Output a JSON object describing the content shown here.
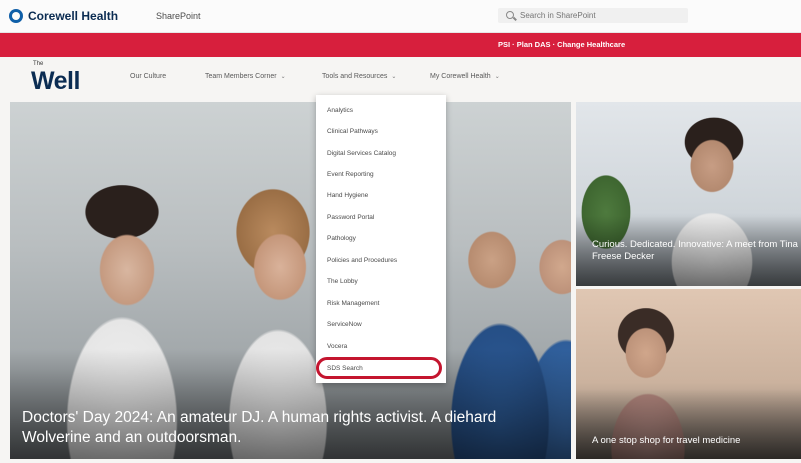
{
  "topbar": {
    "brand": "Corewell Health",
    "app_name": "SharePoint",
    "search_placeholder": "Search in SharePoint",
    "brand_color": "#0b2c52"
  },
  "alert_banner": {
    "text": "PSI · Plan DAS · Change Healthcare",
    "color": "#d71f3d"
  },
  "site": {
    "logo_prefix": "The",
    "logo_name": "Well"
  },
  "nav": {
    "items": [
      {
        "label": "Our Culture",
        "has_chevron": false
      },
      {
        "label": "Team Members Corner",
        "has_chevron": true
      },
      {
        "label": "Tools and Resources",
        "has_chevron": true
      },
      {
        "label": "My Corewell Health",
        "has_chevron": true
      }
    ]
  },
  "dropdown": {
    "items": [
      "Analytics",
      "Clinical Pathways",
      "Digital Services Catalog",
      "Event Reporting",
      "Hand Hygiene",
      "Password Portal",
      "Pathology",
      "Policies and Procedures",
      "The Lobby",
      "Risk Management",
      "ServiceNow",
      "Vocera",
      "SDS Search"
    ],
    "highlighted_item": "SDS Search",
    "highlight_color": "#c4152f"
  },
  "hero": {
    "caption": "Doctors' Day 2024: An amateur DJ. A human rights activist. A diehard Wolverine and an outdoorsman."
  },
  "side_stories": [
    {
      "caption": "Curious. Dedicated. Innovative: A meet from Tina Freese Decker"
    },
    {
      "caption": "A one stop shop for travel medicine"
    }
  ]
}
